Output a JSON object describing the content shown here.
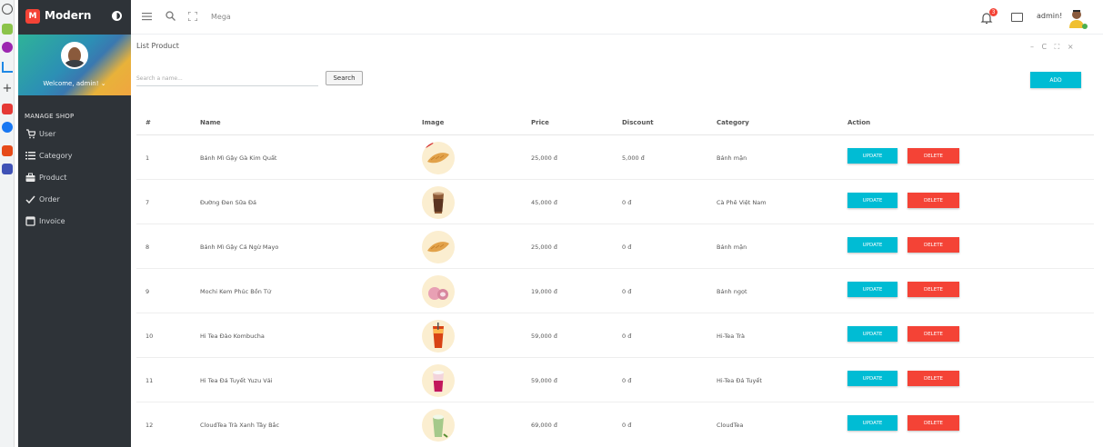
{
  "brand": {
    "logo_letter": "M",
    "name": "Modern"
  },
  "profile": {
    "welcome": "Welcome, admin! ⌄"
  },
  "sidebar": {
    "section": "MANAGE SHOP",
    "items": [
      {
        "label": "User",
        "icon": "cart-icon"
      },
      {
        "label": "Category",
        "icon": "list-icon"
      },
      {
        "label": "Product",
        "icon": "briefcase-icon"
      },
      {
        "label": "Order",
        "icon": "check-icon"
      },
      {
        "label": "Invoice",
        "icon": "invoice-icon"
      }
    ]
  },
  "header": {
    "mega": "Mega",
    "user": "admin!",
    "notifications": "3"
  },
  "card": {
    "title": "List Product",
    "tools": "– C ⛶ ×"
  },
  "search": {
    "placeholder": "Search a name...",
    "button": "Search"
  },
  "add_button": "ADD",
  "table": {
    "headers": [
      "#",
      "Name",
      "Image",
      "Price",
      "Discount",
      "Category",
      "Action"
    ],
    "update_label": "UPDATE",
    "delete_label": "DELETE",
    "rows": [
      {
        "id": "1",
        "name": "Bánh Mì Gậy Gà Kim Quất",
        "price": "25,000 đ",
        "discount": "5,000 đ",
        "category": "Bánh mặn",
        "image": "baguette"
      },
      {
        "id": "7",
        "name": "Đường Đen Sữa Đá",
        "price": "45,000 đ",
        "discount": "0 đ",
        "category": "Cà Phê Việt Nam",
        "image": "milk-coffee"
      },
      {
        "id": "8",
        "name": "Bánh Mì Gậy Cá Ngừ Mayo",
        "price": "25,000 đ",
        "discount": "0 đ",
        "category": "Bánh mặn",
        "image": "baguette"
      },
      {
        "id": "9",
        "name": "Mochi Kem Phúc Bồn Tử",
        "price": "19,000 đ",
        "discount": "0 đ",
        "category": "Bánh ngọt",
        "image": "mochi"
      },
      {
        "id": "10",
        "name": "Hi Tea Đào Kombucha",
        "price": "59,000 đ",
        "discount": "0 đ",
        "category": "Hi-Tea Trà",
        "image": "red-tea"
      },
      {
        "id": "11",
        "name": "Hi Tea Đá Tuyết Yuzu Vải",
        "price": "59,000 đ",
        "discount": "0 đ",
        "category": "Hi-Tea Đá Tuyết",
        "image": "pink-ice"
      },
      {
        "id": "12",
        "name": "CloudTea Trà Xanh Tây Bắc",
        "price": "69,000 đ",
        "discount": "0 đ",
        "category": "CloudTea",
        "image": "green-tea"
      }
    ]
  },
  "colors": {
    "sidebar": "#2e3338",
    "accent": "#00bcd4",
    "danger": "#f44336"
  }
}
